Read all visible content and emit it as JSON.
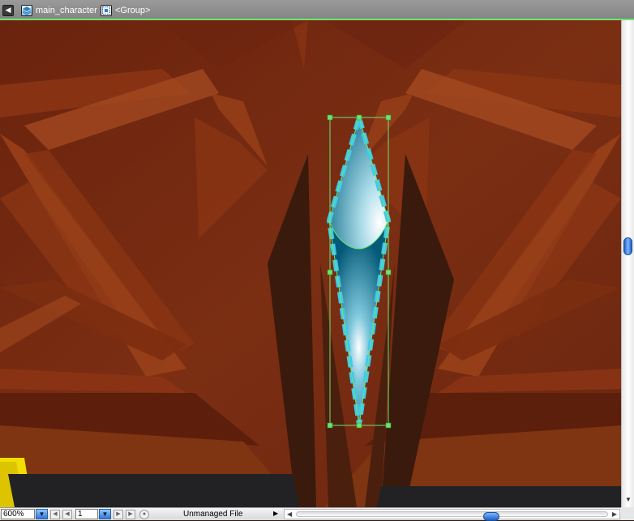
{
  "breadcrumb": {
    "items": [
      {
        "label": "",
        "icon": "back-arrow-icon"
      },
      {
        "label": "main_character",
        "icon": "symbol-icon"
      },
      {
        "label": "<Group>",
        "icon": "group-icon"
      }
    ]
  },
  "statusbar": {
    "zoom": "600%",
    "page": "1",
    "status": "Unmanaged File"
  },
  "colors": {
    "selection": "#6fe36f",
    "stroke_dash": "#40c8ec",
    "background": "#7a2c12",
    "scroll_thumb": "#2f78d8"
  }
}
